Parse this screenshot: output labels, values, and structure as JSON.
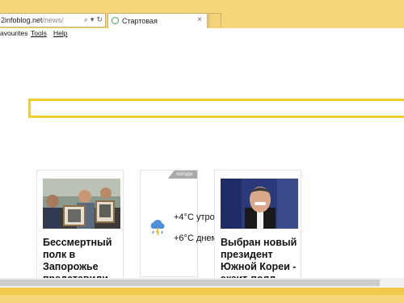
{
  "browser": {
    "address": {
      "host": "2infoblog.net",
      "path": "/news/"
    },
    "address_icons": {
      "search": "⌕",
      "dropdown": "▾",
      "refresh": "↻"
    },
    "tab": {
      "label": "Стартовая",
      "close": "×"
    }
  },
  "menu": [
    "avourites",
    "Tools",
    "Help"
  ],
  "cards": [
    {
      "title": "Бессмертный полк в Запорожье представили"
    },
    {
      "title": "Выбран новый президент Южной Кореи - экзит-полл"
    }
  ],
  "weather": {
    "tag": "погода",
    "morning": "+4°C утром",
    "day": "+6°C днем"
  },
  "colors": {
    "accent": "#f2cd2e",
    "chrome": "#f5d77a"
  }
}
